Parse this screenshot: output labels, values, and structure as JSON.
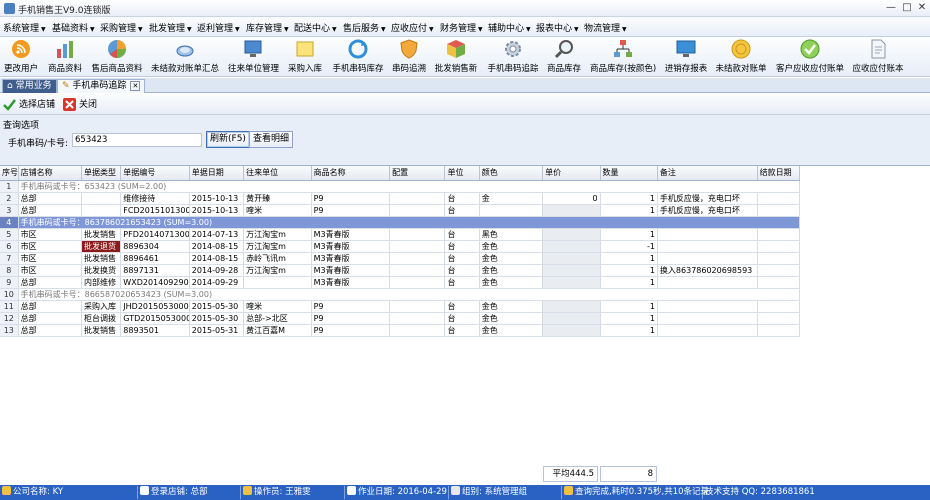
{
  "window": {
    "title": "手机销售王V9.0连锁版",
    "min": "—",
    "max": "□",
    "close": "✕"
  },
  "menu": [
    "系统管理",
    "基础资料",
    "采购管理",
    "批发管理",
    "返利管理",
    "库存管理",
    "配送中心",
    "售后服务",
    "应收应付",
    "财务管理",
    "辅助中心",
    "报表中心",
    "物流管理"
  ],
  "toolbar": [
    {
      "label": "更改用户",
      "icon": "rss-icon"
    },
    {
      "label": "商品资料",
      "icon": "bar-chart-icon"
    },
    {
      "label": "售后商品资料",
      "icon": "pie-chart-icon"
    },
    {
      "label": "未结款对账单汇总",
      "icon": "cloud-icon"
    },
    {
      "label": "往来单位管理",
      "icon": "monitor-icon"
    },
    {
      "label": "采购入库",
      "icon": "folder-icon"
    },
    {
      "label": "手机串码库存",
      "icon": "refresh-icon"
    },
    {
      "label": "串码追溯",
      "icon": "shield-icon"
    },
    {
      "label": "批发销售新",
      "icon": "box-icon"
    },
    {
      "label": "手机串码追踪",
      "icon": "gear-icon"
    },
    {
      "label": "商品库存",
      "icon": "magnifier-icon"
    },
    {
      "label": "商品库存(按颜色)",
      "icon": "network-icon"
    },
    {
      "label": "进销存报表",
      "icon": "screen-icon"
    },
    {
      "label": "未结款对账单",
      "icon": "coin-icon"
    },
    {
      "label": "客户应收应付账单",
      "icon": "check-icon"
    },
    {
      "label": "应收应付账本",
      "icon": "document-icon"
    }
  ],
  "tabs": [
    {
      "label": "常用业务"
    },
    {
      "label": "手机串码追踪"
    }
  ],
  "actions": {
    "select_store": "选择店铺",
    "close": "关闭"
  },
  "query": {
    "section_title": "查询选项",
    "field_label": "手机串码/卡号:",
    "field_value": "653423",
    "refresh": "刷新(F5)",
    "details": "查看明细"
  },
  "grid": {
    "columns": [
      "序号",
      "店铺名称",
      "单据类型",
      "单据编号",
      "单据日期",
      "往来单位",
      "商品名称",
      "配置",
      "单位",
      "颜色",
      "单价",
      "数量",
      "备注",
      "结款日期"
    ],
    "rows": [
      {
        "group": true,
        "n": "1",
        "text": "手机串码或卡号：653423 (SUM=2.00)"
      },
      {
        "n": "2",
        "store": "总部",
        "type": "",
        "no": "维修接待",
        "date": "2015-10-13",
        "partner": "黄开臻",
        "product": "P9",
        "config": "",
        "unit": "台",
        "color": "金",
        "price": "0",
        "qty": "1",
        "note": "手机反应慢，充电口坏",
        "settle": ""
      },
      {
        "n": "3",
        "store": "总部",
        "type": "",
        "no": "FCD201510130000(",
        "date": "2015-10-13",
        "partner": "喹米",
        "product": "P9",
        "config": "",
        "unit": "台",
        "color": "",
        "price": "",
        "qty": "1",
        "note": "手机反应慢，充电口坏",
        "settle": ""
      },
      {
        "group": true,
        "selected": true,
        "n": "4",
        "text": "手机串码或卡号：863786021653423 (SUM=3.00)"
      },
      {
        "n": "5",
        "store": "市区",
        "type": "批发销售",
        "no": "PFD201407130001",
        "date": "2014-07-13",
        "partner": "万江淘宝m",
        "product": "M3青春版",
        "config": "",
        "unit": "台",
        "color": "黑色",
        "price": "",
        "qty": "1",
        "note": "",
        "settle": ""
      },
      {
        "n": "6",
        "store": "市区",
        "type": "批发退货",
        "no": "8896304",
        "date": "2014-08-15",
        "partner": "万江淘宝m",
        "product": "M3青春版",
        "config": "",
        "unit": "台",
        "color": "金色",
        "price": "",
        "qty": "-1",
        "note": "",
        "settle": ""
      },
      {
        "n": "7",
        "store": "市区",
        "type": "批发销售",
        "no": "8896461",
        "date": "2014-08-15",
        "partner": "赤岭飞讯m",
        "product": "M3青春版",
        "config": "",
        "unit": "台",
        "color": "金色",
        "price": "",
        "qty": "1",
        "note": "",
        "settle": ""
      },
      {
        "n": "8",
        "store": "市区",
        "type": "批发换货",
        "no": "8897131",
        "date": "2014-09-28",
        "partner": "万江淘宝m",
        "product": "M3青春版",
        "config": "",
        "unit": "台",
        "color": "金色",
        "price": "",
        "qty": "1",
        "note": "换入863786020698593",
        "settle": ""
      },
      {
        "n": "9",
        "store": "总部",
        "type": "内部维修",
        "no": "WXD201409290001",
        "date": "2014-09-29",
        "partner": "",
        "product": "M3青春版",
        "config": "",
        "unit": "台",
        "color": "金色",
        "price": "",
        "qty": "1",
        "note": "",
        "settle": ""
      },
      {
        "group": true,
        "n": "10",
        "text": "手机串码或卡号：866587020653423 (SUM=3.00)"
      },
      {
        "n": "11",
        "store": "总部",
        "type": "采购入库",
        "no": "JHD201505300001",
        "date": "2015-05-30",
        "partner": "喹米",
        "product": "P9",
        "config": "",
        "unit": "台",
        "color": "金色",
        "price": "",
        "qty": "1",
        "note": "",
        "settle": ""
      },
      {
        "n": "12",
        "store": "总部",
        "type": "柜台调拨",
        "no": "GTD201505300001",
        "date": "2015-05-30",
        "partner": "总部->北区",
        "product": "P9",
        "config": "",
        "unit": "台",
        "color": "金色",
        "price": "",
        "qty": "1",
        "note": "",
        "settle": ""
      },
      {
        "n": "13",
        "store": "总部",
        "type": "批发销售",
        "no": "8893501",
        "date": "2015-05-31",
        "partner": "黄江百嘉M",
        "product": "P9",
        "config": "",
        "unit": "台",
        "color": "金色",
        "price": "",
        "qty": "1",
        "note": "",
        "settle": ""
      }
    ],
    "summary_avg": "平均444.5",
    "summary_qty": "8"
  },
  "status": [
    {
      "label": "公司名称: KY",
      "color": "#f0c040"
    },
    {
      "label": "登录店铺: 总部",
      "color": "#ffffff"
    },
    {
      "label": "操作员: 王雅雯",
      "color": "#f0c040"
    },
    {
      "label": "作业日期: 2016-04-29",
      "color": "#ffffff"
    },
    {
      "label": "组别: 系统管理组",
      "color": "#e8e8e8"
    },
    {
      "label": "查询完成,耗时0.375秒,共10条记录",
      "color": "#f0c040"
    },
    {
      "label": "技术支持 QQ: 2283681861",
      "color": ""
    }
  ]
}
